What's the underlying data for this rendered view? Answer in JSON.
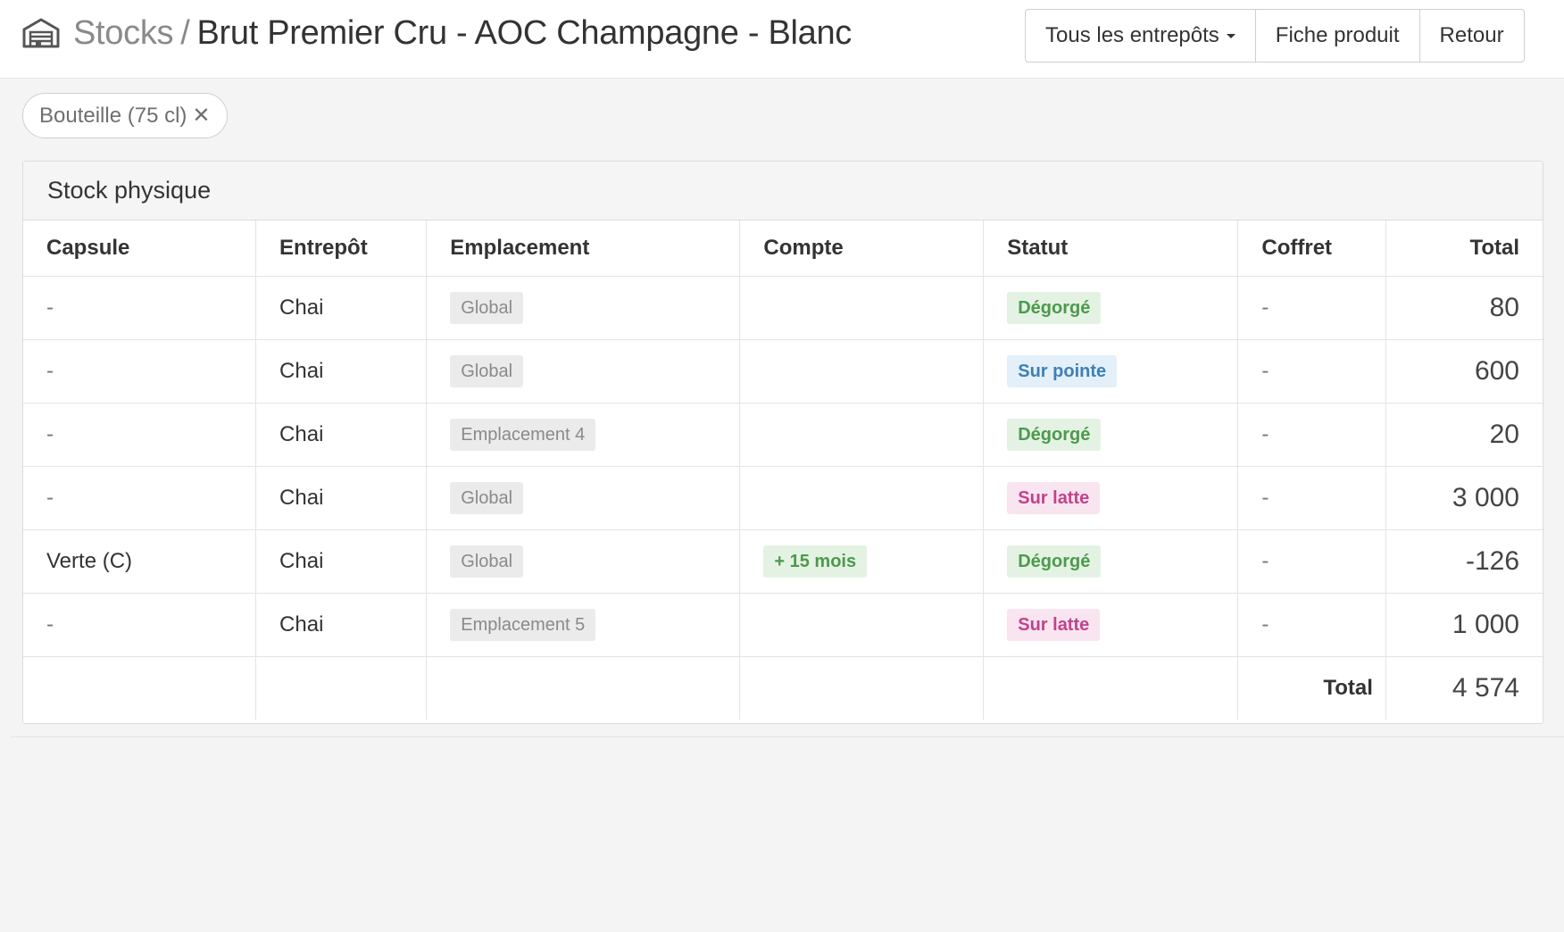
{
  "header": {
    "icon": "warehouse-icon",
    "breadcrumb_root": "Stocks",
    "breadcrumb_separator": "/",
    "breadcrumb_current": "Brut Premier Cru - AOC Champagne - Blanc",
    "buttons": {
      "warehouses": "Tous les entrepôts",
      "product_sheet": "Fiche produit",
      "back": "Retour"
    }
  },
  "filter_chip": {
    "label": "Bouteille (75 cl)",
    "remove": "✕"
  },
  "panel": {
    "title": "Stock physique",
    "columns": [
      "Capsule",
      "Entrepôt",
      "Emplacement",
      "Compte",
      "Statut",
      "Coffret",
      "Total"
    ],
    "rows": [
      {
        "capsule": "-",
        "entrepot": "Chai",
        "emplacement": "Global",
        "compte": "",
        "statut": "Dégorgé",
        "coffret": "-",
        "total": "80"
      },
      {
        "capsule": "-",
        "entrepot": "Chai",
        "emplacement": "Global",
        "compte": "",
        "statut": "Sur pointe",
        "coffret": "-",
        "total": "600"
      },
      {
        "capsule": "-",
        "entrepot": "Chai",
        "emplacement": "Emplacement 4",
        "compte": "",
        "statut": "Dégorgé",
        "coffret": "-",
        "total": "20"
      },
      {
        "capsule": "-",
        "entrepot": "Chai",
        "emplacement": "Global",
        "compte": "",
        "statut": "Sur latte",
        "coffret": "-",
        "total": "3 000"
      },
      {
        "capsule": "Verte (C)",
        "entrepot": "Chai",
        "emplacement": "Global",
        "compte": "+ 15 mois",
        "statut": "Dégorgé",
        "coffret": "-",
        "total": "-126"
      },
      {
        "capsule": "-",
        "entrepot": "Chai",
        "emplacement": "Emplacement 5",
        "compte": "",
        "statut": "Sur latte",
        "coffret": "-",
        "total": "1 000"
      }
    ],
    "footer": {
      "label": "Total",
      "value": "4 574"
    }
  },
  "colors": {
    "status_degorge": "#4c9a4c",
    "status_sur_pointe": "#3f7fb5",
    "status_sur_latte": "#c2428a",
    "location_label": "#8a8a8a"
  }
}
